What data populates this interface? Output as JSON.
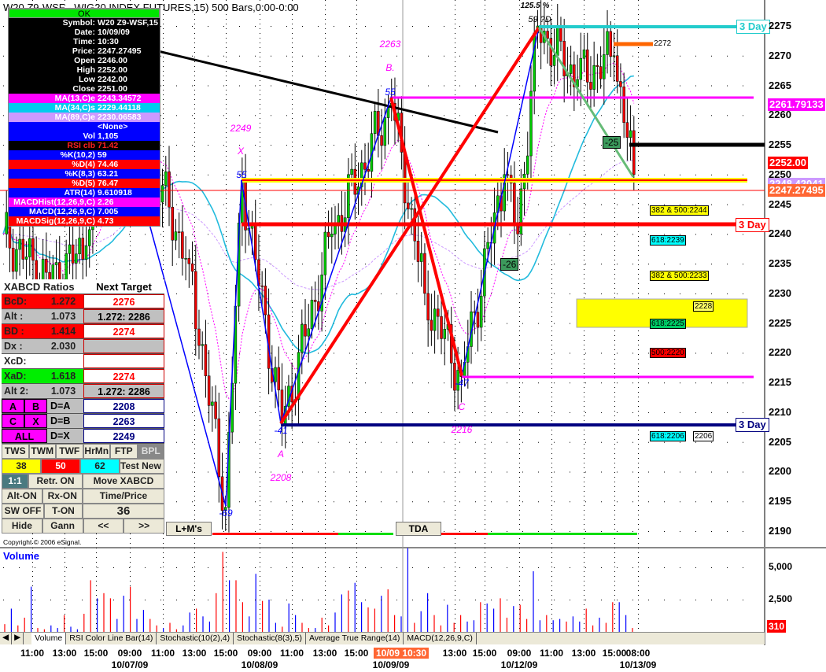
{
  "title": "W20 Z9-WSF - WIG20 INDEX FUTURES,15) 500 Bars,0:00-0:00",
  "data_window": {
    "ok": "OK",
    "rows": [
      {
        "k": "Symbol:",
        "v": "W20 Z9-WSF,15",
        "bg": "#000000",
        "fg": "#ffffff"
      },
      {
        "k": "Date:",
        "v": "10/09/09",
        "bg": "#000000",
        "fg": "#ffffff"
      },
      {
        "k": "Time:",
        "v": "10:30",
        "bg": "#000000",
        "fg": "#ffffff"
      },
      {
        "k": "Price:",
        "v": "2247.27495",
        "bg": "#000000",
        "fg": "#ffffff"
      },
      {
        "k": "Open",
        "v": "2246.00",
        "bg": "#000000",
        "fg": "#ffffff"
      },
      {
        "k": "High",
        "v": "2252.00",
        "bg": "#000000",
        "fg": "#ffffff"
      },
      {
        "k": "Low",
        "v": "2242.00",
        "bg": "#000000",
        "fg": "#ffffff"
      },
      {
        "k": "Close",
        "v": "2251.00",
        "bg": "#000000",
        "fg": "#ffffff"
      },
      {
        "k": "MA(13,C)e",
        "v": "2243.34572",
        "bg": "#ff00ff",
        "fg": "#ffffff"
      },
      {
        "k": "MA(34,C)s",
        "v": "2229.44118",
        "bg": "#00ccee",
        "fg": "#ffffff"
      },
      {
        "k": "MA(89,C)e",
        "v": "2230.06583",
        "bg": "#cc99ff",
        "fg": "#ffffff"
      },
      {
        "k": "",
        "v": "<None>",
        "bg": "#0000ff",
        "fg": "#ffffff"
      },
      {
        "k": "Vol",
        "v": "1,105",
        "bg": "#0000ff",
        "fg": "#ffffff"
      },
      {
        "k": "RSI clb",
        "v": "71.42",
        "bg": "#000000",
        "fg": "#ff2020"
      },
      {
        "k": "%K(10,2)",
        "v": "59",
        "bg": "#0000ff",
        "fg": "#ffffff"
      },
      {
        "k": "%D(4)",
        "v": "74.46",
        "bg": "#ff0000",
        "fg": "#ffffff"
      },
      {
        "k": "%K(8,3)",
        "v": "63.21",
        "bg": "#0000ff",
        "fg": "#ffffff"
      },
      {
        "k": "%D(5)",
        "v": "76.47",
        "bg": "#ff0000",
        "fg": "#ffffff"
      },
      {
        "k": "ATR(14)",
        "v": "9.610918",
        "bg": "#0000ff",
        "fg": "#ffffff"
      },
      {
        "k": "MACDHist(12,26,9,C)",
        "v": "2.26",
        "bg": "#ff00ff",
        "fg": "#ffffff"
      },
      {
        "k": "MACD(12,26,9,C)",
        "v": "7.005",
        "bg": "#0000ff",
        "fg": "#ffffff"
      },
      {
        "k": "MACDSig(12,26,9,C)",
        "v": "4.73",
        "bg": "#ff0000",
        "fg": "#ffffff"
      }
    ]
  },
  "xabcd": {
    "header_left": "XABCD Ratios",
    "header_right": "Next Target",
    "rows": [
      {
        "k": "BcD:",
        "r": "1.272",
        "t": "2276",
        "bg": "#ff0000",
        "tc": "#ff0000"
      },
      {
        "k": "Alt  :",
        "r": "1.073",
        "t": "1.272: 2286",
        "bg": "#c0c0c0",
        "tc": "#000000"
      },
      {
        "k": "BD  :",
        "r": "1.414",
        "t": "2274",
        "bg": "#ff0000",
        "tc": "#ff0000"
      },
      {
        "k": "Dx  :",
        "r": "2.030",
        "t": "",
        "bg": "#c0c0c0",
        "tc": "#000000"
      },
      {
        "k": "XcD:",
        "r": "",
        "t": "",
        "bg": "#ffffff",
        "tc": "#000000"
      },
      {
        "k": "XaD:",
        "r": "1.618",
        "t": "2274",
        "bg": "#00ee00",
        "tc": "#ff0000"
      },
      {
        "k": "Alt 2:",
        "r": "1.073",
        "t": "1.272: 2286",
        "bg": "#c0c0c0",
        "tc": "#000000"
      }
    ],
    "proj": [
      {
        "a": "A",
        "b": "B",
        "l": "D=A",
        "t": "2208"
      },
      {
        "a": "C",
        "b": "X",
        "l": "D=B",
        "t": "2263"
      },
      {
        "a": "ALL",
        "b": "",
        "l": "D=X",
        "t": "2249"
      }
    ],
    "tools": [
      "TWS",
      "TWM",
      "TWF",
      "HrMn",
      "FTP",
      "BPL"
    ],
    "fibs": [
      "38",
      "50",
      "62"
    ],
    "test_new": "Test New D=?",
    "ratio": "1:1",
    "retr": "Retr. ON",
    "move": "Move XABCD",
    "alt_on": "Alt-ON",
    "rx_on": "Rx-ON",
    "time_price": "Time/Price",
    "sw_off": "SW OFF",
    "t_on": "T-ON",
    "count": "36",
    "hide": "Hide",
    "gann": "Gann",
    "prev": "<<",
    "next": ">>"
  },
  "buttons": {
    "lm": "L+M's",
    "tda": "TDA"
  },
  "copyright": "Copyright © 2006 eSignal.",
  "pattern_labels": {
    "pct": "125.5 %",
    "d": "59 ?D",
    "b_price": "2263",
    "b": "B.",
    "b_n": "55",
    "x_price": "2249",
    "x": "X",
    "x_n": "55",
    "a_n": "-41",
    "a": "A",
    "a_price": "2208",
    "c_n": "-47",
    "c": "C",
    "c_price": "2216",
    "low_n": "-69",
    "g1": "-25",
    "g2": "-26"
  },
  "fib_labels": [
    {
      "t": "382 & 500:2244",
      "bg": "#ffff00",
      "p": 2244
    },
    {
      "t": "618:2239",
      "bg": "#00ffff",
      "p": 2239
    },
    {
      "t": "382 & 500:2233",
      "bg": "#ffff00",
      "p": 2233
    },
    {
      "t": "618:2225",
      "bg": "#00cc66",
      "p": 2225
    },
    {
      "t": "500:2220",
      "bg": "#ff0000",
      "p": 2220
    },
    {
      "t": "618:2206",
      "bg": "#00ffff",
      "p": 2206
    }
  ],
  "side_labels": {
    "l2228": "2228",
    "l2206": "2206",
    "l2272": "2272"
  },
  "three_day": {
    "top": "3 Day",
    "mid": "3 Day",
    "bot": "3 Day"
  },
  "price_badges": [
    {
      "t": "2261.79133",
      "bg": "#ff00ff",
      "p": 2261.79
    },
    {
      "t": "2252.00",
      "bg": "#ff0000",
      "p": 2252
    },
    {
      "t": "2248.42041",
      "bg": "#cc99ff",
      "p": 2248.42
    },
    {
      "t": "2247.27495",
      "bg": "#ff6633",
      "p": 2247.27
    }
  ],
  "volume": {
    "label": "Volume",
    "ticks": [
      "5,000",
      "2,500"
    ],
    "last": "310"
  },
  "tabs": [
    "Volume",
    "RSI Color Line Bar(14)",
    "Stochastic(10(2),4)",
    "Stochastic(8(3),5)",
    "Average True Range(14)",
    "MACD(12,26,9,C)"
  ],
  "time_labels": [
    "11:00",
    "13:00",
    "15:00",
    "09:00",
    "11:00",
    "13:00",
    "15:00",
    "09:00",
    "11:00",
    "13:00",
    "15:00",
    "10/09 10:30",
    "13:00",
    "15:00",
    "09:00",
    "11:00",
    "13:00",
    "15:00",
    "08:00"
  ],
  "date_labels": [
    "10/07/09",
    "10/08/09",
    "10/09/09",
    "10/12/09",
    "10/13/09"
  ],
  "chart_data": {
    "type": "candlestick",
    "ylim": [
      2190,
      2275
    ],
    "y_ticks": [
      2275,
      2270,
      2265,
      2260,
      2255,
      2250,
      2245,
      2240,
      2235,
      2230,
      2225,
      2220,
      2215,
      2210,
      2205,
      2200,
      2195,
      2190
    ],
    "price_path": [
      [
        0,
        2240
      ],
      [
        14,
        2232
      ],
      [
        25,
        2238
      ],
      [
        35,
        2262
      ],
      [
        44,
        2253
      ],
      [
        56,
        2235
      ],
      [
        67,
        2194
      ],
      [
        72,
        2249
      ],
      [
        84,
        2208
      ],
      [
        99,
        2240
      ],
      [
        117,
        2262
      ],
      [
        127,
        2230
      ],
      [
        138,
        2216
      ],
      [
        151,
        2250
      ],
      [
        155,
        2240
      ],
      [
        161,
        2275
      ],
      [
        173,
        2266
      ],
      [
        184,
        2270
      ],
      [
        190,
        2250
      ]
    ],
    "volume_values": [
      600,
      1800,
      500,
      1100,
      3500,
      300,
      200,
      500,
      300,
      1300,
      400,
      200,
      1400,
      4000,
      2600,
      3000,
      2600,
      1000,
      2800,
      3500,
      1000,
      1700,
      1000,
      500,
      300,
      700,
      200,
      500,
      1500,
      1800,
      1200,
      800,
      3000,
      6200,
      4000,
      4000,
      2300,
      1200,
      4500,
      2400,
      2500,
      700,
      400,
      2200,
      1300,
      700,
      300,
      300,
      1100,
      500,
      1500,
      2900,
      3200,
      3800,
      2300,
      1900,
      1800,
      2800,
      3300,
      1300,
      1200,
      6500,
      700,
      1600,
      3000,
      1300,
      500,
      2100,
      700,
      1300,
      800,
      900,
      2300,
      2200,
      1800,
      2600,
      1100,
      2000,
      2100,
      1000,
      4700,
      900,
      1300,
      900,
      1000,
      800,
      1200,
      800,
      1800,
      500,
      1100,
      700,
      2300,
      2300,
      1300,
      300
    ]
  }
}
